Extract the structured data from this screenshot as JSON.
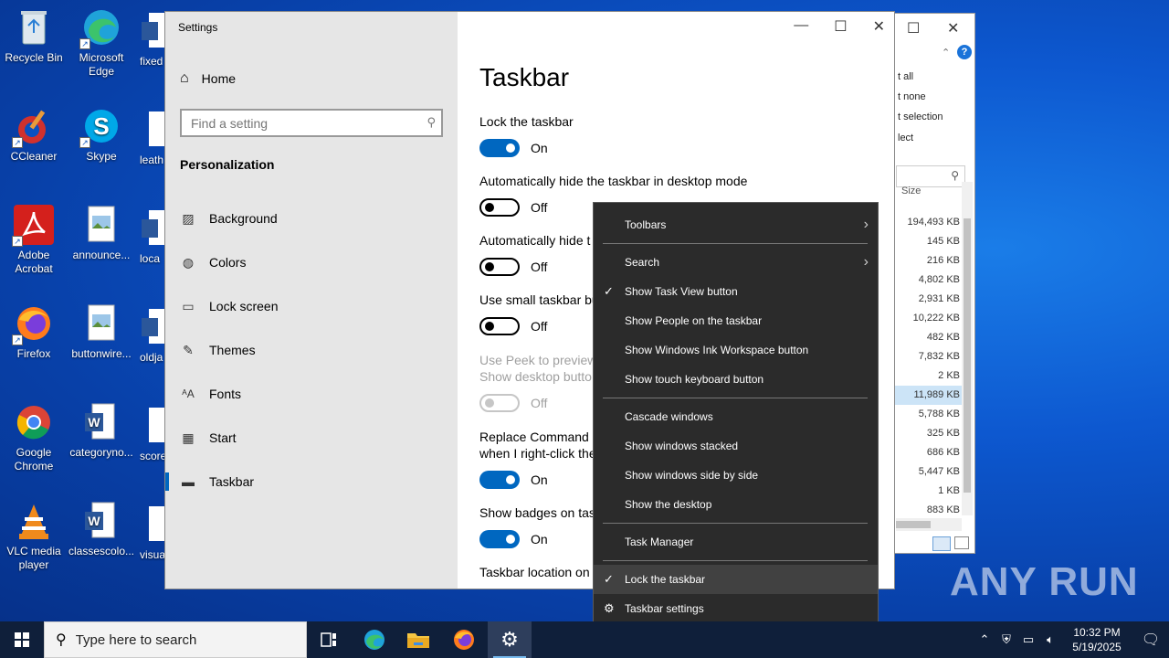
{
  "desktop": {
    "icons": [
      {
        "label": "Recycle Bin"
      },
      {
        "label": "Microsoft Edge"
      },
      {
        "label": "CCleaner"
      },
      {
        "label": "Skype"
      },
      {
        "label": "Adobe Acrobat"
      },
      {
        "label": "announce..."
      },
      {
        "label": "Firefox"
      },
      {
        "label": "buttonwire..."
      },
      {
        "label": "Google Chrome"
      },
      {
        "label": "categoryno..."
      },
      {
        "label": "VLC media player"
      },
      {
        "label": "classescolo..."
      }
    ],
    "cut_icons": [
      "fixed",
      "leath",
      "loca",
      "oldja",
      "score",
      "visua"
    ]
  },
  "explorer": {
    "links": [
      "t all",
      "t none",
      "t selection",
      "lect"
    ],
    "column_header": "Size",
    "sizes": [
      "194,493 KB",
      "145 KB",
      "216 KB",
      "4,802 KB",
      "2,931 KB",
      "10,222 KB",
      "482 KB",
      "7,832 KB",
      "2 KB",
      "11,989 KB",
      "5,788 KB",
      "325 KB",
      "686 KB",
      "5,447 KB",
      "1 KB",
      "883 KB"
    ],
    "selected_index": 9
  },
  "settings": {
    "window_title": "Settings",
    "home_label": "Home",
    "search_placeholder": "Find a setting",
    "section_title": "Personalization",
    "nav": [
      {
        "label": "Background",
        "icon": "image-icon"
      },
      {
        "label": "Colors",
        "icon": "palette-icon"
      },
      {
        "label": "Lock screen",
        "icon": "monitor-icon"
      },
      {
        "label": "Themes",
        "icon": "brush-icon"
      },
      {
        "label": "Fonts",
        "icon": "font-icon"
      },
      {
        "label": "Start",
        "icon": "start-icon"
      },
      {
        "label": "Taskbar",
        "icon": "taskbar-icon"
      }
    ],
    "active_nav": "Taskbar",
    "page_title": "Taskbar",
    "options": [
      {
        "label": "Lock the taskbar",
        "state": "On"
      },
      {
        "label": "Automatically hide the taskbar in desktop mode",
        "state": "Off"
      },
      {
        "label": "Automatically hide t",
        "state": "Off"
      },
      {
        "label": "Use small taskbar bu",
        "state": "Off"
      },
      {
        "label": "Use Peek to preview",
        "label2": "Show desktop butto",
        "state": "Off",
        "disabled": true
      },
      {
        "label": "Replace Command P",
        "label2": "when I right-click the",
        "state": "On"
      },
      {
        "label": "Show badges on tas",
        "state": "On"
      }
    ],
    "location_label": "Taskbar location on s"
  },
  "context_menu": {
    "items": [
      {
        "label": "Toolbars",
        "submenu": true
      },
      {
        "label": "Search",
        "submenu": true
      },
      {
        "label": "Show Task View button",
        "checked": true
      },
      {
        "label": "Show People on the taskbar"
      },
      {
        "label": "Show Windows Ink Workspace button"
      },
      {
        "label": "Show touch keyboard button"
      },
      {
        "label": "Cascade windows"
      },
      {
        "label": "Show windows stacked"
      },
      {
        "label": "Show windows side by side"
      },
      {
        "label": "Show the desktop"
      },
      {
        "label": "Task Manager"
      },
      {
        "label": "Lock the taskbar",
        "checked": true,
        "highlighted": true
      },
      {
        "label": "Taskbar settings",
        "icon": "gear-icon"
      }
    ]
  },
  "taskbar": {
    "search_placeholder": "Type here to search",
    "time": "10:32 PM",
    "date": "5/19/2025"
  },
  "watermark": "ANY RUN",
  "colors": {
    "accent": "#0067c0",
    "menu_bg": "#2b2b2b",
    "taskbar_bg": "#0f1f3a"
  }
}
